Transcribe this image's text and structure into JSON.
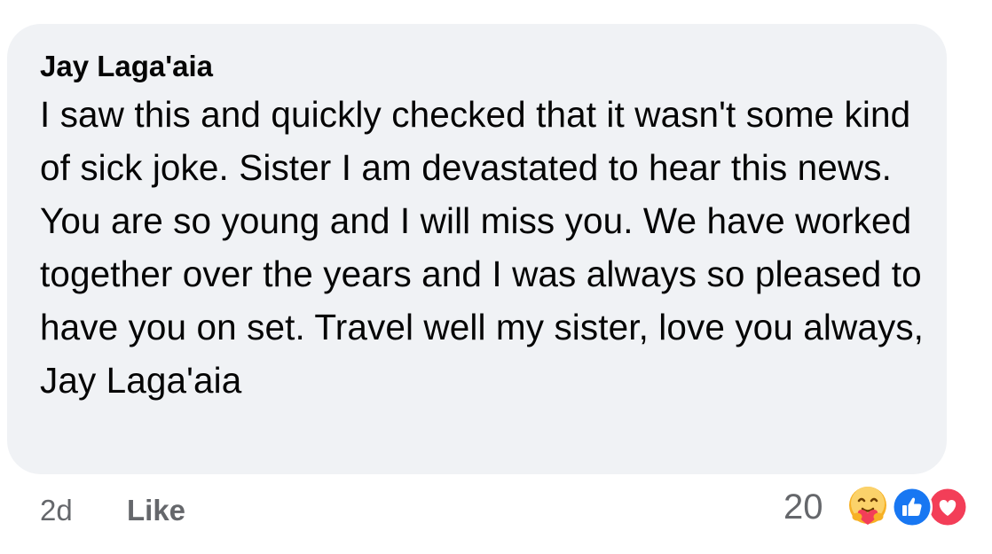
{
  "comment": {
    "author": "Jay Laga'aia",
    "text": "I saw this and quickly checked that it wasn't some kind of sick joke. Sister I am devastated to hear this news. You are so young and I will miss you. We have worked together over the years and I was always so pleased to have you on set. Travel well my sister, love you always, Jay Laga'aia"
  },
  "footer": {
    "timestamp": "2d",
    "like_label": "Like"
  },
  "reactions": {
    "count": "20",
    "icons": [
      "care-emoji-icon",
      "like-thumb-icon",
      "love-heart-icon"
    ]
  },
  "colors": {
    "bubble_bg": "#f0f2f5",
    "text": "#050505",
    "secondary": "#65676b",
    "like_blue": "#1877f2",
    "love_red": "#f33e58",
    "care_yellow": "#f7b125"
  }
}
